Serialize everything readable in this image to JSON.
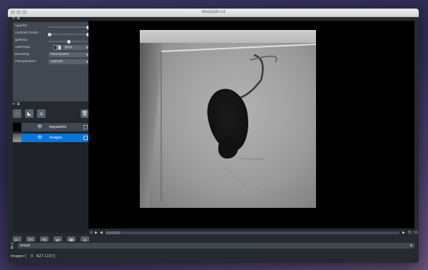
{
  "window": {
    "title": "deeplabcut"
  },
  "controls": {
    "opacity_label": "opacity:",
    "opacity_value": 1.0,
    "contrast_label": "contrast limits:",
    "contrast_value": [
      0,
      1
    ],
    "gamma_label": "gamma:",
    "gamma_value": 0.5,
    "colormap_label": "colormap:",
    "colormap_value": "gray",
    "blending_label": "blending:",
    "blending_value": "translucent",
    "interpolation_label": "interpolation:",
    "interpolation_value": "nearest"
  },
  "layer_tools": [
    "points-tool",
    "shapes-tool",
    "labels-tool",
    "delete-layer"
  ],
  "layers": [
    {
      "name": "keypoints",
      "selected": false,
      "type_icon": "points-icon"
    },
    {
      "name": "images",
      "selected": true,
      "type_icon": "image-icon"
    }
  ],
  "bottom_buttons": [
    "console",
    "ndisplay",
    "roll",
    "transpose",
    "grid",
    "home"
  ],
  "timeline": {
    "frame": "0",
    "end": "11",
    "progress": 0.05
  },
  "console": {
    "text": "snout"
  },
  "status": {
    "text": "images [    0   627 1157]"
  },
  "colors": {
    "accent": "#0a74d8",
    "panel": "#414851",
    "bg": "#262930"
  }
}
